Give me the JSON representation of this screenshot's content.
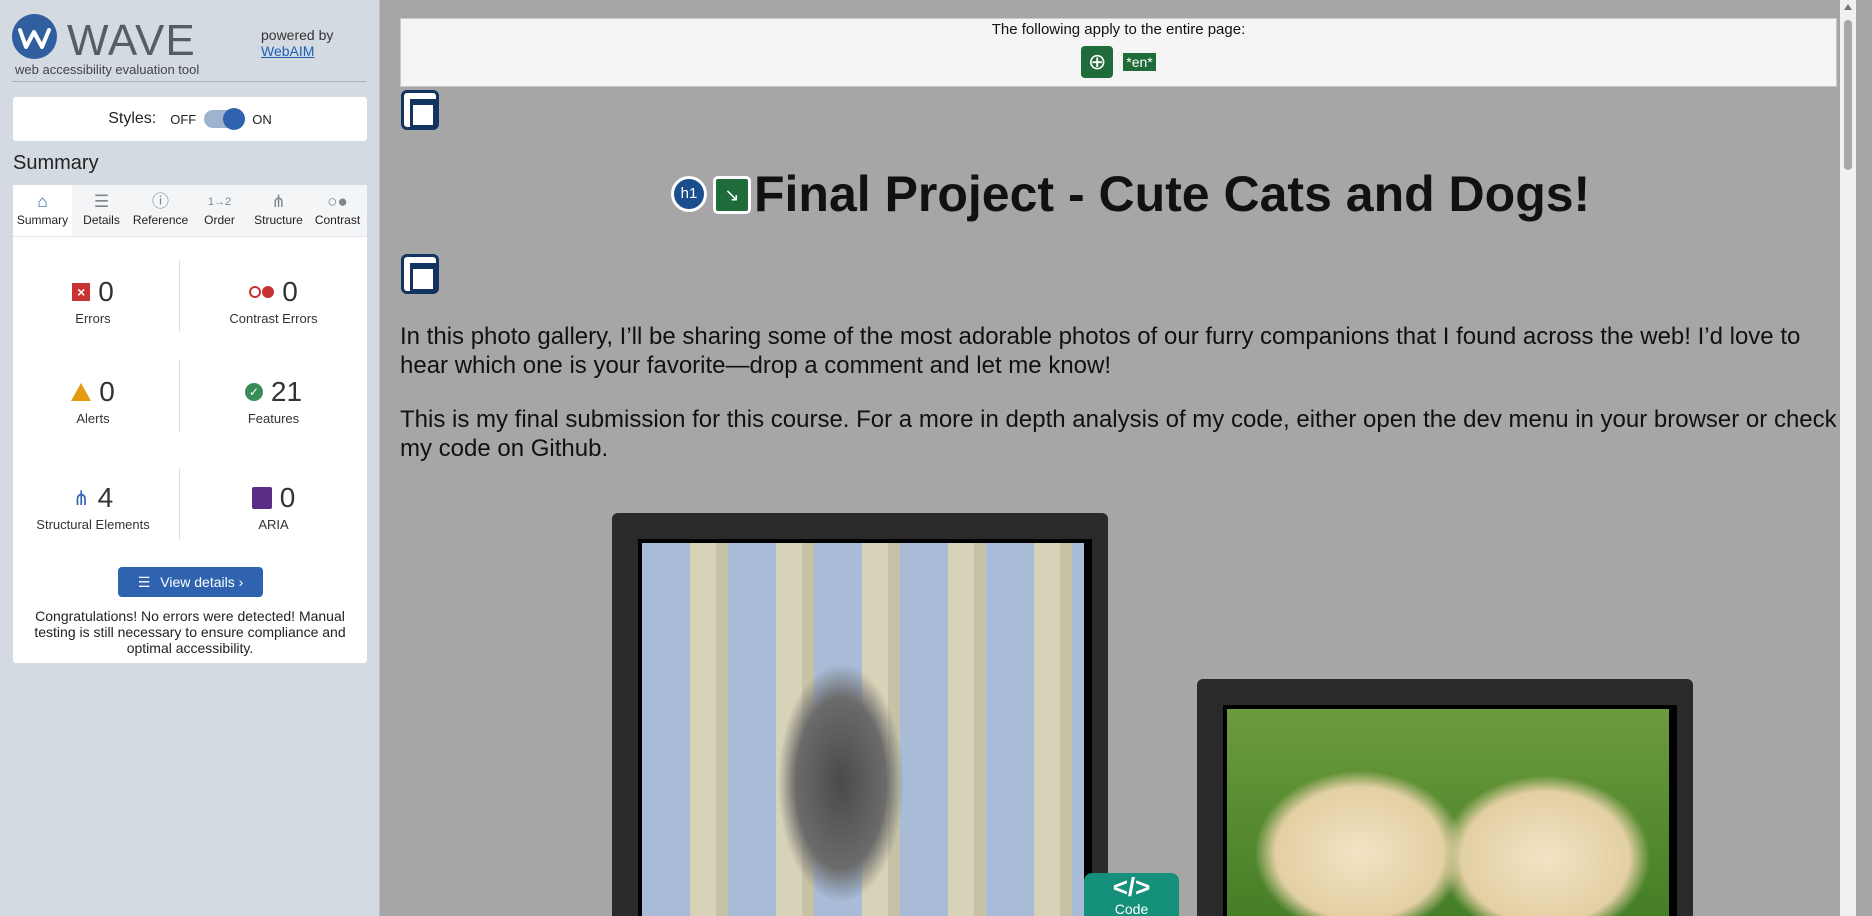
{
  "sidebar": {
    "logo_word": "WAVE",
    "tagline": "web accessibility evaluation tool",
    "powered_by": "powered by",
    "webaim_link": "WebAIM",
    "styles_label": "Styles:",
    "styles_off": "OFF",
    "styles_on": "ON",
    "summary_title": "Summary",
    "tabs": [
      {
        "label": "Summary",
        "icon": "home-icon"
      },
      {
        "label": "Details",
        "icon": "list-icon"
      },
      {
        "label": "Reference",
        "icon": "info-icon"
      },
      {
        "label": "Order",
        "icon": "order-icon"
      },
      {
        "label": "Structure",
        "icon": "structure-icon"
      },
      {
        "label": "Contrast",
        "icon": "contrast-icon"
      }
    ],
    "stats": {
      "errors": {
        "count": "0",
        "label": "Errors"
      },
      "contrast_errors": {
        "count": "0",
        "label": "Contrast Errors"
      },
      "alerts": {
        "count": "0",
        "label": "Alerts"
      },
      "features": {
        "count": "21",
        "label": "Features"
      },
      "structural": {
        "count": "4",
        "label": "Structural Elements"
      },
      "aria": {
        "count": "0",
        "label": "ARIA"
      }
    },
    "view_details": "View details ›",
    "congrats": "Congratulations! No errors were detected! Manual testing is still necessary to ensure compliance and optimal accessibility."
  },
  "main": {
    "banner_text": "The following apply to the entire page:",
    "lang_badge": "*en*",
    "h1_badge": "h1",
    "heading": "Final Project - Cute Cats and Dogs!",
    "para1": "In this photo gallery, I’ll be sharing some of the most adorable photos of our furry companions that I found across the web! I’d love to hear which one is your favorite—drop a comment and let me know!",
    "para2": "This is my final submission for this course. For a more in depth analysis of my code, either open the dev menu in your browser or check my code on Github.",
    "code_symbol": "</>",
    "code_label": "Code"
  },
  "colors": {
    "accent": "#2f63b0",
    "error": "#c83232",
    "feature": "#3a8b5a",
    "alert": "#e39b12",
    "aria": "#5a2d86",
    "code": "#15907a"
  }
}
